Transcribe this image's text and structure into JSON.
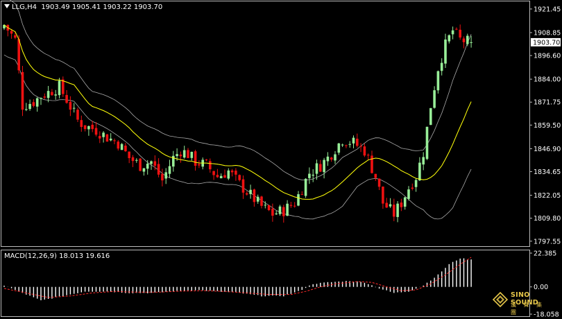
{
  "header": {
    "symbol": "LLG,H4",
    "ohlc": "1903.49 1905.41 1903.22 1903.70"
  },
  "macd_header": {
    "label": "MACD(12,26,9) 18.013 19.616"
  },
  "logo": {
    "line1": "SINO SOUND",
    "line2": "漢 聲 集 團"
  },
  "colors": {
    "background": "#000000",
    "bull": "#98ee98",
    "bear": "#ee1111",
    "ma": "#ffff00",
    "bands": "#aaaaaa",
    "macd_hist": "#ffffff",
    "macd_signal": "#ff2a2a"
  },
  "chart_data": {
    "type": "candlestick",
    "price_axis": {
      "ticks": [
        "1921.45",
        "1908.85",
        "1896.60",
        "1884.00",
        "1871.75",
        "1859.50",
        "1846.90",
        "1834.65",
        "1822.05",
        "1809.80",
        "1797.55"
      ],
      "ylim": [
        1794.5,
        1925.5
      ],
      "current_price": "1903.70"
    },
    "macd_axis": {
      "ticks": [
        "22.385",
        "0.00",
        "-18.058"
      ],
      "ylim": [
        -18.058,
        22.385
      ]
    },
    "close_path": [
      [
        0,
        1913
      ],
      [
        3,
        1905
      ],
      [
        5,
        1870
      ],
      [
        8,
        1872
      ],
      [
        10,
        1875
      ],
      [
        13,
        1878
      ],
      [
        15,
        1880
      ],
      [
        17,
        1873
      ],
      [
        20,
        1862
      ],
      [
        22,
        1859
      ],
      [
        25,
        1857
      ],
      [
        28,
        1853
      ],
      [
        31,
        1850
      ],
      [
        34,
        1842
      ],
      [
        37,
        1838
      ],
      [
        40,
        1840
      ],
      [
        43,
        1830
      ],
      [
        46,
        1842
      ],
      [
        48,
        1846
      ],
      [
        50,
        1844
      ],
      [
        52,
        1840
      ],
      [
        55,
        1838
      ],
      [
        58,
        1832
      ],
      [
        61,
        1835
      ],
      [
        64,
        1828
      ],
      [
        67,
        1822
      ],
      [
        70,
        1816
      ],
      [
        73,
        1812
      ],
      [
        76,
        1814
      ],
      [
        79,
        1818
      ],
      [
        81,
        1826
      ],
      [
        83,
        1834
      ],
      [
        86,
        1838
      ],
      [
        88,
        1842
      ],
      [
        90,
        1847
      ],
      [
        92,
        1852
      ],
      [
        95,
        1850
      ],
      [
        98,
        1846
      ],
      [
        101,
        1832
      ],
      [
        103,
        1818
      ],
      [
        106,
        1812
      ],
      [
        108,
        1818
      ],
      [
        110,
        1826
      ],
      [
        112,
        1832
      ],
      [
        114,
        1845
      ],
      [
        116,
        1870
      ],
      [
        118,
        1890
      ],
      [
        120,
        1902
      ],
      [
        122,
        1910
      ],
      [
        124,
        1905
      ],
      [
        126,
        1904
      ],
      [
        127,
        1903.7
      ]
    ],
    "histogram_path": [
      [
        0,
        1
      ],
      [
        5,
        -4
      ],
      [
        10,
        -9
      ],
      [
        14,
        -7
      ],
      [
        18,
        -5
      ],
      [
        22,
        -3
      ],
      [
        28,
        -3
      ],
      [
        34,
        -4
      ],
      [
        40,
        -4
      ],
      [
        46,
        -3
      ],
      [
        52,
        -2
      ],
      [
        58,
        -3
      ],
      [
        64,
        -4
      ],
      [
        70,
        -6
      ],
      [
        76,
        -6
      ],
      [
        80,
        -3
      ],
      [
        84,
        2
      ],
      [
        88,
        3
      ],
      [
        94,
        4
      ],
      [
        98,
        3
      ],
      [
        102,
        -1
      ],
      [
        106,
        -4
      ],
      [
        110,
        -3
      ],
      [
        114,
        1
      ],
      [
        118,
        8
      ],
      [
        121,
        15
      ],
      [
        124,
        19
      ],
      [
        127,
        18
      ]
    ],
    "signal_path": [
      [
        0,
        -1
      ],
      [
        6,
        -4
      ],
      [
        12,
        -7
      ],
      [
        18,
        -6
      ],
      [
        24,
        -4
      ],
      [
        30,
        -3
      ],
      [
        36,
        -3.5
      ],
      [
        42,
        -3.5
      ],
      [
        48,
        -2.8
      ],
      [
        54,
        -2.5
      ],
      [
        60,
        -3
      ],
      [
        66,
        -4
      ],
      [
        72,
        -5
      ],
      [
        78,
        -5
      ],
      [
        82,
        -3
      ],
      [
        86,
        0
      ],
      [
        90,
        2
      ],
      [
        96,
        3.5
      ],
      [
        100,
        3
      ],
      [
        104,
        0
      ],
      [
        108,
        -2.5
      ],
      [
        112,
        -2
      ],
      [
        116,
        2
      ],
      [
        120,
        8
      ],
      [
        124,
        15
      ],
      [
        127,
        19.6
      ]
    ],
    "band_width_path": [
      [
        0,
        16
      ],
      [
        6,
        14
      ],
      [
        12,
        12
      ],
      [
        18,
        9
      ],
      [
        24,
        8
      ],
      [
        30,
        9
      ],
      [
        36,
        9
      ],
      [
        44,
        11
      ],
      [
        50,
        12
      ],
      [
        56,
        10
      ],
      [
        62,
        10
      ],
      [
        68,
        12
      ],
      [
        74,
        12
      ],
      [
        80,
        10
      ],
      [
        86,
        11
      ],
      [
        92,
        13
      ],
      [
        96,
        10
      ],
      [
        102,
        11
      ],
      [
        108,
        12
      ],
      [
        114,
        16
      ],
      [
        118,
        26
      ],
      [
        122,
        34
      ],
      [
        127,
        36
      ]
    ]
  }
}
